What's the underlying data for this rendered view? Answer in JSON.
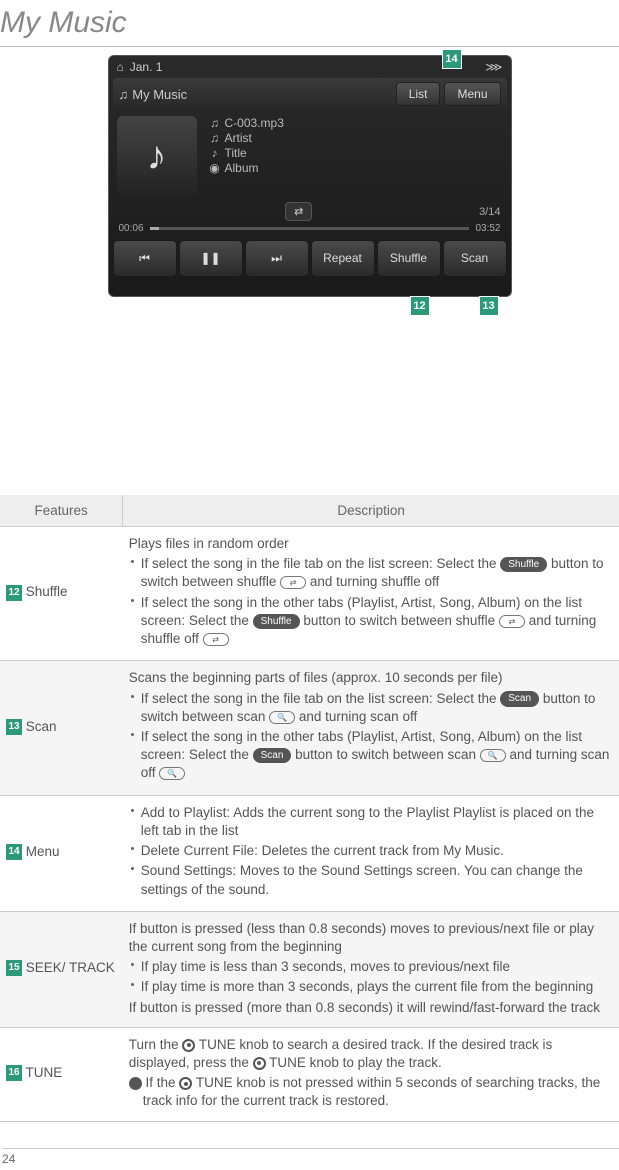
{
  "page_title": "My Music",
  "page_number": "24",
  "screenshot": {
    "date": "Jan. 1",
    "home_icon": "home-icon",
    "wifi_icon": "wifi-icon",
    "app_title": "My Music",
    "btn_list": "List",
    "btn_menu": "Menu",
    "file_name": "C-003.mp3",
    "artist_label": "Artist",
    "title_label": "Title",
    "album_label": "Album",
    "track_count": "3/14",
    "time_elapsed": "00:06",
    "time_total": "03:52",
    "ctl_prev": "⏮",
    "ctl_pause": "❚❚",
    "ctl_next": "⏭",
    "ctl_repeat": "Repeat",
    "ctl_shuffle": "Shuffle",
    "ctl_scan": "Scan"
  },
  "callouts": {
    "c12": "12",
    "c13": "13",
    "c14": "14"
  },
  "table": {
    "header_features": "Features",
    "header_description": "Description",
    "labels": {
      "shuffle_pill": "Shuffle",
      "scan_pill": "Scan",
      "tune_label": "TUNE"
    },
    "rows": [
      {
        "num": "12",
        "feature": "Shuffle",
        "lead": "Plays files in random order",
        "bullets": [
          {
            "pre": "If select the song in the file tab on the list screen: Select the ",
            "pill": "Shuffle",
            "post1": " button to switch between shuffle ",
            "oval1": "⇄",
            "post2": " and turning shuffle off"
          },
          {
            "pre": "If select the song in the other tabs (Playlist, Artist, Song, Album) on the list screen: Select the ",
            "pill": "Shuffle",
            "post1": " button to switch between shuffle ",
            "oval1": "⇄",
            "post2": " and turning shuffle off ",
            "oval2": "⇄"
          }
        ]
      },
      {
        "num": "13",
        "feature": "Scan",
        "lead": "Scans the beginning parts of files (approx. 10 seconds per file)",
        "bullets": [
          {
            "pre": "If select the song in the file tab on the list screen: Select the ",
            "pill": "Scan",
            "post1": " button to switch between scan ",
            "oval1": "🔍",
            "post2": " and turning scan off"
          },
          {
            "pre": "If select the song in the other tabs (Playlist, Artist, Song, Album) on the list screen: Select the ",
            "pill": "Scan",
            "post1": " button to switch between scan ",
            "oval1": "🔍",
            "post2": " and turning scan off ",
            "oval2": "🔍"
          }
        ]
      },
      {
        "num": "14",
        "feature": "Menu",
        "bullets_plain": [
          "Add to Playlist: Adds the current song to the Playlist Playlist is placed on the left tab in the list",
          "Delete Current File: Deletes the current track from My Music.",
          "Sound Settings: Moves to the Sound Settings screen. You can change the settings of the sound."
        ]
      },
      {
        "num": "15",
        "feature": "SEEK/ TRACK",
        "lead": "If button is pressed (less than 0.8 seconds) moves to previous/next file or play the current song from the beginning",
        "bullets_plain": [
          "If play time is less than 3 seconds, moves to previous/next file",
          "If play time is more than 3 seconds, plays the current file from the beginning"
        ],
        "tail": "If button is pressed (more than 0.8 seconds) it will rewind/fast-forward the track"
      },
      {
        "num": "16",
        "feature": "TUNE",
        "tune_text": {
          "p1a": "Turn the ",
          "p1b": " TUNE knob to search a desired track. If the desired track is displayed, press the ",
          "p1c": " knob to play the track.",
          "p2a": " If the ",
          "p2b": " TUNE knob is not pressed within 5 seconds of searching tracks, the track info for the current track is restored."
        }
      }
    ]
  }
}
